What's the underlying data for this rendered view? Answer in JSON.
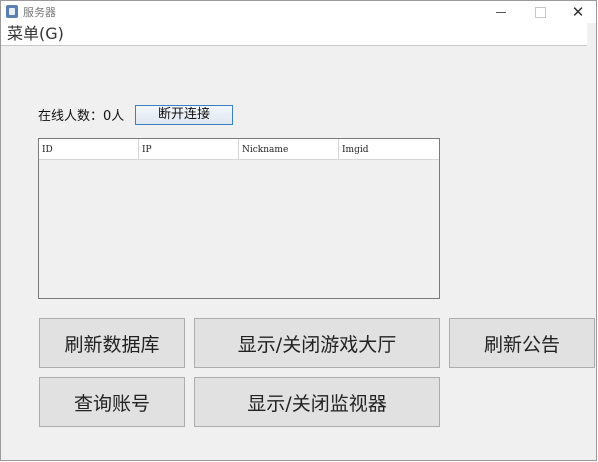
{
  "window": {
    "title": "服务器",
    "icon": "java-app-icon",
    "controls": {
      "minimize": "minimize-icon",
      "maximize": "maximize-icon",
      "close": "✕"
    }
  },
  "menubar": {
    "menu_label": "菜单(G)"
  },
  "status": {
    "online_count_label": "在线人数：0人"
  },
  "buttons": {
    "disconnect": "断开连接"
  },
  "table": {
    "columns": [
      "ID",
      "IP",
      "Nickname",
      "Imgid"
    ],
    "rows": []
  },
  "actions": {
    "refresh_db": "刷新数据库",
    "toggle_lobby": "显示/关闭游戏大厅",
    "refresh_notice": "刷新公告",
    "query_account": "查询账号",
    "toggle_monitor": "显示/关闭监视器"
  },
  "colors": {
    "window_bg": "#f0f0f0",
    "button_bg": "#e1e1e1",
    "focus_border": "#3c7fc1"
  }
}
